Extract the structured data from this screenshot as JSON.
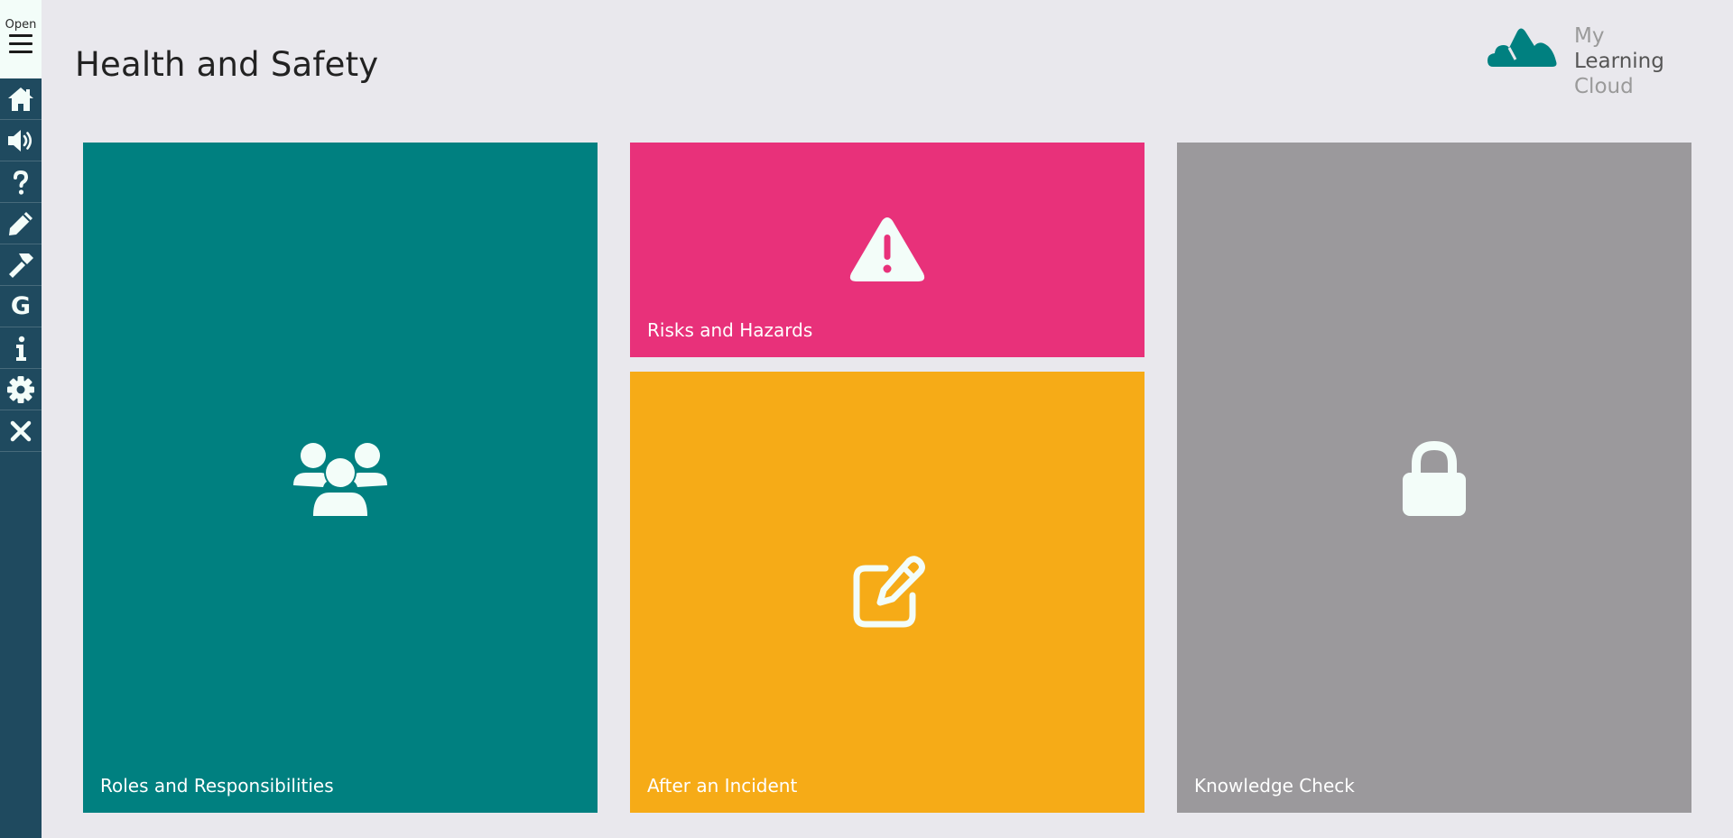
{
  "app": {
    "title": "Health and Safety",
    "logo": {
      "word1": "My",
      "word2": "Learning",
      "word3": "Cloud",
      "mark_color": "#008080"
    }
  },
  "sidebar": {
    "open_label": "Open",
    "items": [
      {
        "name": "home",
        "icon": "home-icon"
      },
      {
        "name": "audio",
        "icon": "volume-icon"
      },
      {
        "name": "help",
        "icon": "question-icon"
      },
      {
        "name": "notes",
        "icon": "pencil-icon"
      },
      {
        "name": "tools",
        "icon": "hammer-icon"
      },
      {
        "name": "glossary",
        "icon": "letter-g-icon",
        "text": "G"
      },
      {
        "name": "info",
        "icon": "info-icon"
      },
      {
        "name": "settings",
        "icon": "gear-icon"
      },
      {
        "name": "close",
        "icon": "close-icon"
      }
    ],
    "background": "#1f4a5f"
  },
  "tiles": [
    {
      "label": "Roles and Responsibilities",
      "icon": "users-icon",
      "color": "#008080",
      "locked": false
    },
    {
      "label": "Risks and Hazards",
      "icon": "warning-icon",
      "color": "#e8317a",
      "locked": false
    },
    {
      "label": "After an Incident",
      "icon": "edit-icon",
      "color": "#f6ab17",
      "locked": false
    },
    {
      "label": "Knowledge Check",
      "icon": "lock-icon",
      "color": "#9b999c",
      "locked": true
    }
  ]
}
